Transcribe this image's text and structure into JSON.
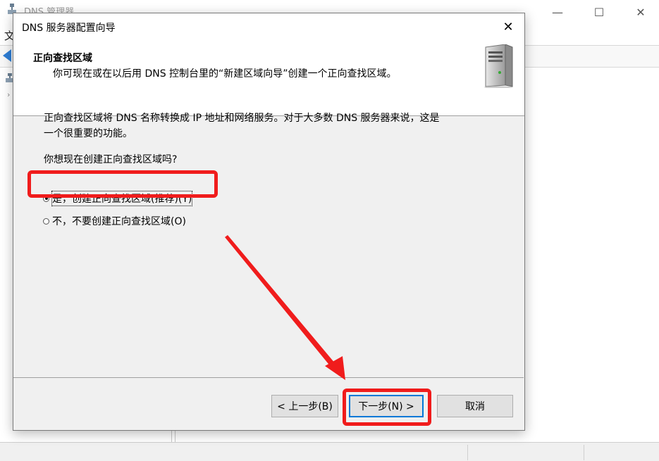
{
  "background_app": {
    "title": "DNS 管理器",
    "menu_first_char": "文",
    "window_controls": {
      "minimize": "—",
      "maximize": "☐",
      "close": "✕"
    }
  },
  "dialog": {
    "title": "DNS 服务器配置向导",
    "close_glyph": "✕",
    "header": {
      "title": "正向查找区域",
      "subtitle": "你可现在或在以后用 DNS 控制台里的“新建区域向导”创建一个正向查找区域。"
    },
    "description_line1": "正向查找区域将 DNS 名称转换成 IP 地址和网络服务。对于大多数 DNS 服务器来说，这是",
    "description_line2": "一个很重要的功能。",
    "question": "你想现在创建正向查找区域吗?",
    "options": [
      {
        "label": "是，创建正向查找区域(推荐)(Y)",
        "selected": true
      },
      {
        "label": "不，不要创建正向查找区域(O)",
        "selected": false
      }
    ],
    "buttons": {
      "back": "< 上一步(B)",
      "next": "下一步(N) >",
      "cancel": "取消"
    }
  },
  "annotation_color": "#f01c1c",
  "icons": [
    "dns-app-icon",
    "back-arrow-icon",
    "server-icon",
    "close-icon"
  ]
}
